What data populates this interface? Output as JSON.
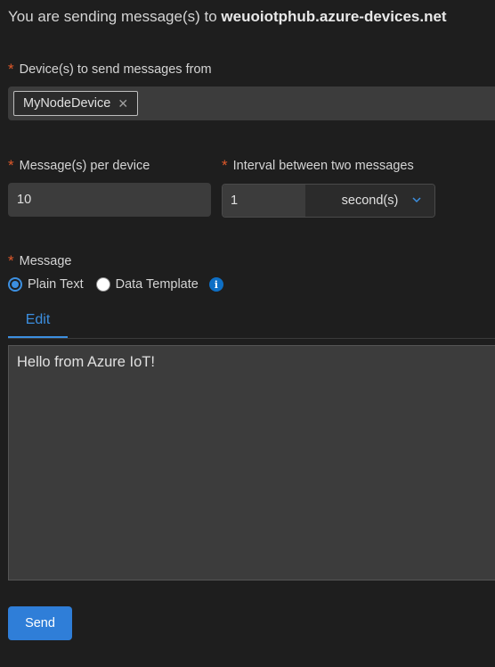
{
  "header": {
    "prefix": "You are sending message(s) to",
    "hub": "weuoiotphub.azure-devices.net"
  },
  "required_marker": "*",
  "devices": {
    "label": "Device(s) to send messages from",
    "selected": [
      "MyNodeDevice"
    ],
    "remove_glyph": "✕"
  },
  "messages_per_device": {
    "label": "Message(s) per device",
    "value": "10"
  },
  "interval": {
    "label": "Interval between two messages",
    "value": "1",
    "unit": "second(s)"
  },
  "message": {
    "label": "Message",
    "options": [
      {
        "label": "Plain Text",
        "selected": true
      },
      {
        "label": "Data Template",
        "selected": false
      }
    ],
    "info_icon": "info-icon"
  },
  "tabs": [
    {
      "label": "Edit",
      "active": true
    }
  ],
  "editor": {
    "content": "Hello from Azure IoT!"
  },
  "actions": {
    "send_label": "Send"
  },
  "colors": {
    "background": "#1e1e1e",
    "accent": "#3c8fe0",
    "required": "#e0592a",
    "button": "#2f7ed8"
  }
}
